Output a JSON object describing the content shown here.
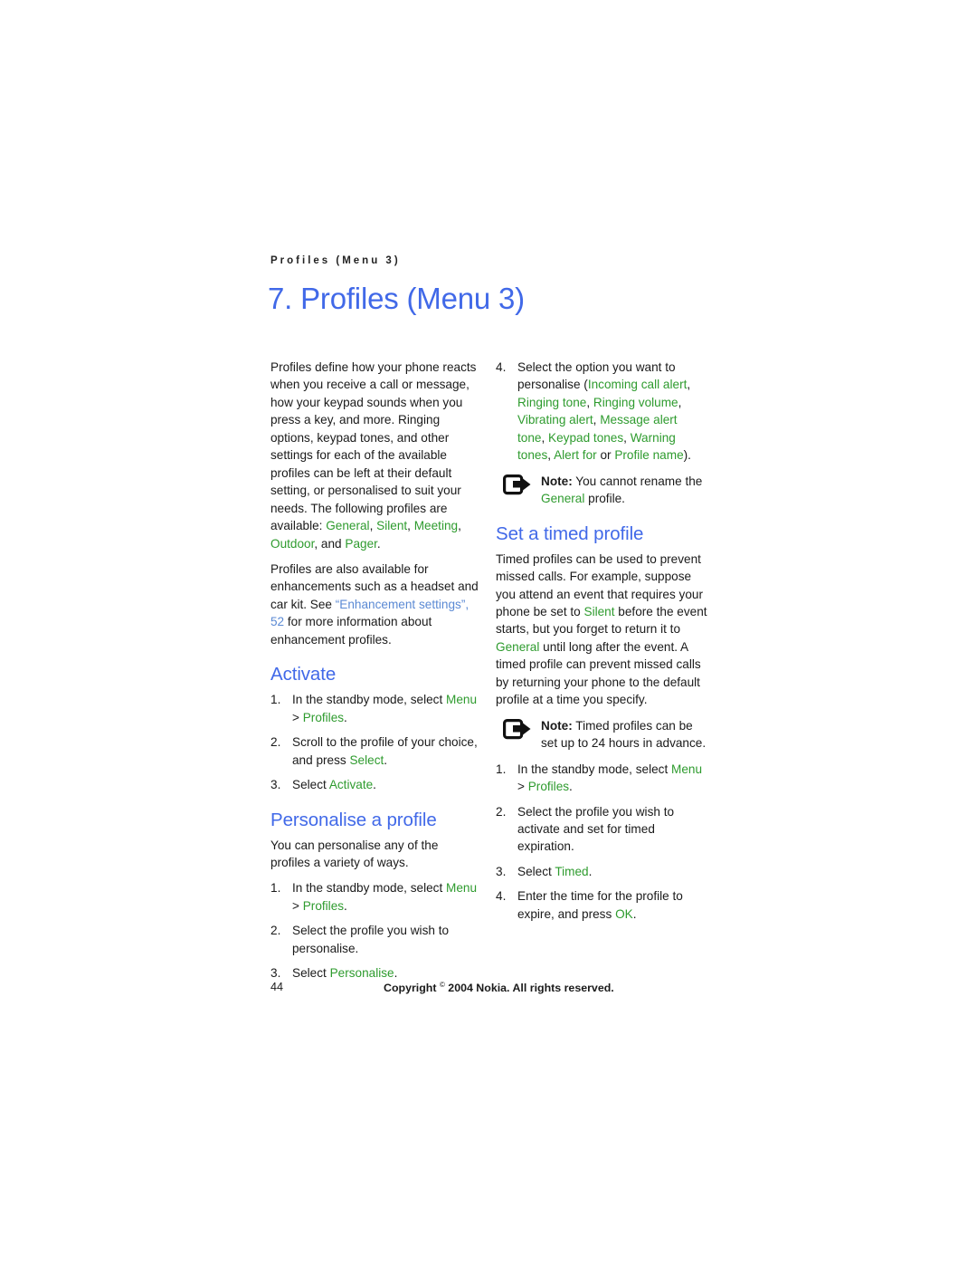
{
  "header": {
    "running_header": "Profiles (Menu 3)",
    "chapter_title": "7. Profiles (Menu 3)"
  },
  "colors": {
    "heading_blue": "#4169e8",
    "ui_term_green": "#2e9b2e",
    "link_blue": "#5b8ad4",
    "body_text": "#1a1a1a"
  },
  "left_column": {
    "intro_paragraph": {
      "part1": "Profiles define how your phone reacts when you receive a call or message, how your keypad sounds when you press a key, and more. Ringing options, keypad tones, and other settings for each of the available profiles can be left at their default setting, or personalised to suit your needs. The following profiles are available: ",
      "profile_general": "General",
      "sep1": ", ",
      "profile_silent": "Silent",
      "sep2": ", ",
      "profile_meeting": "Meeting",
      "sep3": ", ",
      "profile_outdoor": "Outdoor",
      "sep4": ", and ",
      "profile_pager": "Pager",
      "sep5": "."
    },
    "enhancements_paragraph": {
      "part1": "Profiles are also available for enhancements such as a headset and car kit. See ",
      "link": "“Enhancement settings”, 52",
      "part2": " for more information about enhancement profiles."
    },
    "activate": {
      "heading": "Activate",
      "steps": [
        {
          "text_before": "In the standby mode, select ",
          "ui1": "Menu",
          "text_mid": " > ",
          "ui2": "Profiles",
          "text_after": "."
        },
        {
          "text_before": "Scroll to the profile of your choice, and press ",
          "ui1": "Select",
          "text_after": "."
        },
        {
          "text_before": "Select ",
          "ui1": "Activate",
          "text_after": "."
        }
      ]
    },
    "personalise": {
      "heading": "Personalise a profile",
      "intro": "You can personalise any of the profiles a variety of ways.",
      "steps": [
        {
          "text_before": "In the standby mode, select ",
          "ui1": "Menu",
          "text_mid": " > ",
          "ui2": "Profiles",
          "text_after": "."
        },
        {
          "text_before": "Select the profile you wish to personalise.",
          "ui1": "",
          "text_after": ""
        },
        {
          "text_before": "Select ",
          "ui1": "Personalise",
          "text_after": "."
        }
      ]
    }
  },
  "right_column": {
    "step4": {
      "number": "4.",
      "text_before": "Select the option you want to personalise (",
      "options": [
        "Incoming call alert",
        "Ringing tone",
        "Ringing volume",
        "Vibrating alert",
        "Message alert tone",
        "Keypad tones",
        "Warning tones",
        "Alert for"
      ],
      "separator": ", ",
      "text_or": " or ",
      "last_option": "Profile name",
      "text_after": ")."
    },
    "note1": {
      "icon": "note-arrow-icon",
      "label": "Note:",
      "text_before": " You cannot rename the ",
      "ui1": "General",
      "text_after": " profile."
    },
    "timed": {
      "heading": "Set a timed profile",
      "paragraph": {
        "part1": "Timed profiles can be used to prevent missed calls. For example, suppose you attend an event that requires your phone be set to ",
        "ui1": "Silent",
        "part2": " before the event starts, but you forget to return it to ",
        "ui2": "General",
        "part3": " until long after the event. A timed profile can prevent missed calls by returning your phone to the default profile at a time you specify."
      },
      "note2": {
        "icon": "note-arrow-icon",
        "label": "Note:",
        "text": " Timed profiles can be set up to 24 hours in advance."
      },
      "steps": [
        {
          "text_before": "In the standby mode, select ",
          "ui1": "Menu",
          "text_mid": " > ",
          "ui2": "Profiles",
          "text_after": "."
        },
        {
          "text_before": "Select the profile you wish to activate and set for timed expiration.",
          "ui1": "",
          "text_after": ""
        },
        {
          "text_before": "Select ",
          "ui1": "Timed",
          "text_after": "."
        },
        {
          "text_before": "Enter the time for the profile to expire, and press ",
          "ui1": "OK",
          "text_after": "."
        }
      ]
    }
  },
  "footer": {
    "page_number": "44",
    "copyright_before": "Copyright ",
    "copyright_symbol": "©",
    "copyright_after": " 2004 Nokia. All rights reserved."
  }
}
